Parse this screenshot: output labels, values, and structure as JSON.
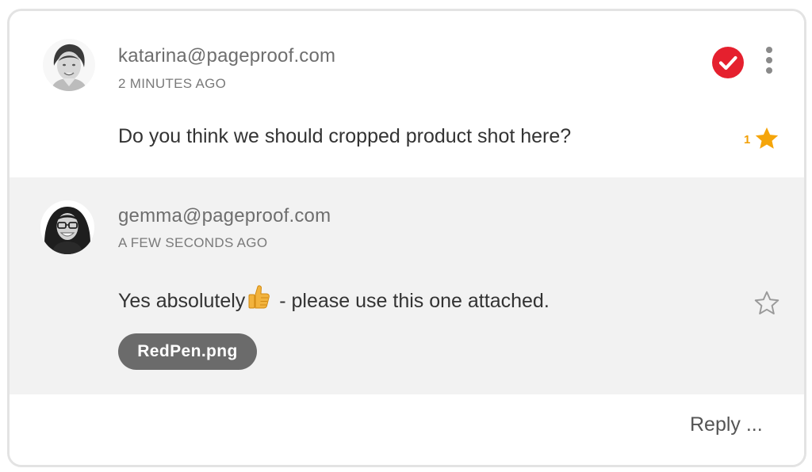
{
  "comments": [
    {
      "author": "katarina@pageproof.com",
      "time": "2 MINUTES AGO",
      "text": "Do you think we should cropped product shot here?",
      "star_count": "1",
      "starred": true,
      "resolved": true
    },
    {
      "author": "gemma@pageproof.com",
      "time": "A FEW SECONDS AGO",
      "text_before": "Yes absolutely",
      "emoji": "thumbs-up-emoji",
      "text_after": " - please use this one attached.",
      "starred": false,
      "attachment": "RedPen.png"
    }
  ],
  "reply": {
    "label": "Reply ..."
  },
  "colors": {
    "resolved_red": "#e5202e",
    "star_gold": "#f5a50a",
    "reply_background": "#f2f2f2",
    "attachment_pill": "#6b6b6b"
  },
  "icons": [
    "check-circle-icon",
    "more-vertical-icon",
    "star-filled-icon",
    "star-outline-icon",
    "thumbs-up-emoji"
  ]
}
